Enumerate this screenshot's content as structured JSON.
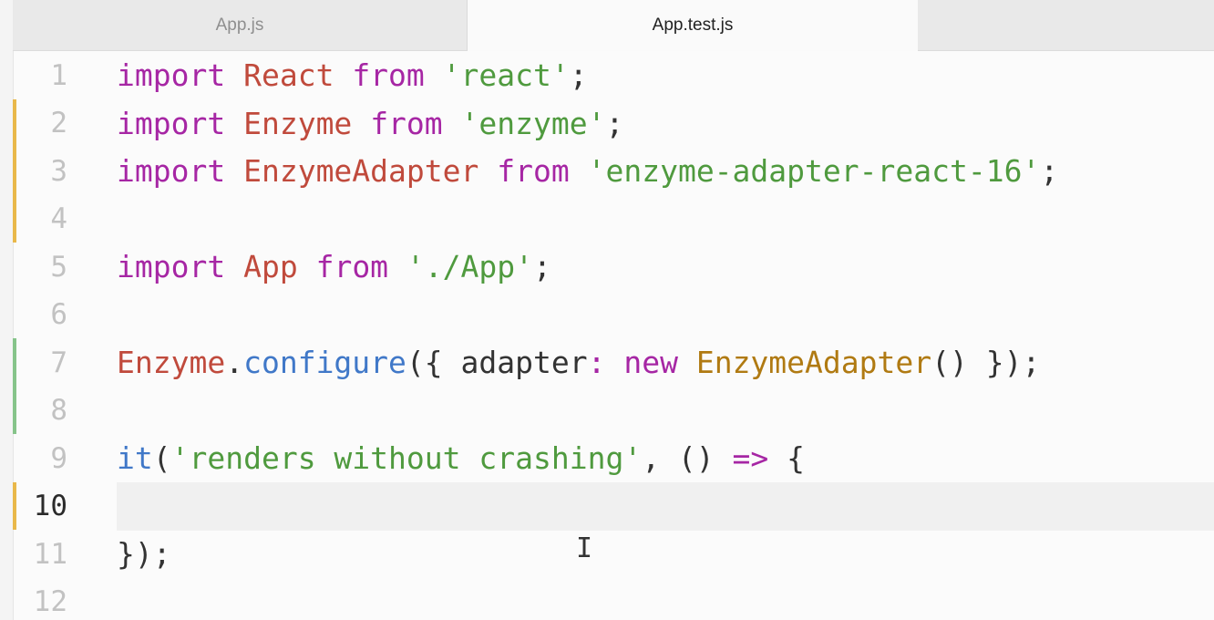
{
  "tabs": [
    {
      "label": "App.js",
      "active": false
    },
    {
      "label": "App.test.js",
      "active": true
    }
  ],
  "colors": {
    "keyword": "#a626a4",
    "class": "#c04a3c",
    "string": "#4f9a3e",
    "function": "#4078c8",
    "constructor": "#b07a12",
    "modified_marker": "#e9b84a",
    "added_marker": "#86c48a"
  },
  "lines": [
    {
      "number": "1",
      "tokens": [
        {
          "t": "import",
          "c": "kw"
        },
        {
          "t": " ",
          "c": "pun"
        },
        {
          "t": "React",
          "c": "cls"
        },
        {
          "t": " ",
          "c": "pun"
        },
        {
          "t": "from",
          "c": "kw"
        },
        {
          "t": " ",
          "c": "pun"
        },
        {
          "t": "'react'",
          "c": "str"
        },
        {
          "t": ";",
          "c": "pun"
        }
      ]
    },
    {
      "number": "2",
      "tokens": [
        {
          "t": "import",
          "c": "kw"
        },
        {
          "t": " ",
          "c": "pun"
        },
        {
          "t": "Enzyme",
          "c": "cls"
        },
        {
          "t": " ",
          "c": "pun"
        },
        {
          "t": "from",
          "c": "kw"
        },
        {
          "t": " ",
          "c": "pun"
        },
        {
          "t": "'enzyme'",
          "c": "str"
        },
        {
          "t": ";",
          "c": "pun"
        }
      ]
    },
    {
      "number": "3",
      "tokens": [
        {
          "t": "import",
          "c": "kw"
        },
        {
          "t": " ",
          "c": "pun"
        },
        {
          "t": "EnzymeAdapter",
          "c": "cls"
        },
        {
          "t": " ",
          "c": "pun"
        },
        {
          "t": "from",
          "c": "kw"
        },
        {
          "t": " ",
          "c": "pun"
        },
        {
          "t": "'enzyme-adapter-react-16'",
          "c": "str"
        },
        {
          "t": ";",
          "c": "pun"
        }
      ]
    },
    {
      "number": "4",
      "tokens": []
    },
    {
      "number": "5",
      "tokens": [
        {
          "t": "import",
          "c": "kw"
        },
        {
          "t": " ",
          "c": "pun"
        },
        {
          "t": "App",
          "c": "cls"
        },
        {
          "t": " ",
          "c": "pun"
        },
        {
          "t": "from",
          "c": "kw"
        },
        {
          "t": " ",
          "c": "pun"
        },
        {
          "t": "'./App'",
          "c": "str"
        },
        {
          "t": ";",
          "c": "pun"
        }
      ]
    },
    {
      "number": "6",
      "tokens": []
    },
    {
      "number": "7",
      "tokens": [
        {
          "t": "Enzyme",
          "c": "cls"
        },
        {
          "t": ".",
          "c": "pun"
        },
        {
          "t": "configure",
          "c": "fn"
        },
        {
          "t": "({ adapter",
          "c": "pun"
        },
        {
          "t": ":",
          "c": "kw"
        },
        {
          "t": " ",
          "c": "pun"
        },
        {
          "t": "new",
          "c": "kw"
        },
        {
          "t": " ",
          "c": "pun"
        },
        {
          "t": "EnzymeAdapter",
          "c": "ctor"
        },
        {
          "t": "() });",
          "c": "pun"
        }
      ]
    },
    {
      "number": "8",
      "tokens": []
    },
    {
      "number": "9",
      "tokens": [
        {
          "t": "it",
          "c": "fn"
        },
        {
          "t": "(",
          "c": "pun"
        },
        {
          "t": "'renders without crashing'",
          "c": "str"
        },
        {
          "t": ", () ",
          "c": "pun"
        },
        {
          "t": "=>",
          "c": "kw"
        },
        {
          "t": " {",
          "c": "pun"
        }
      ]
    },
    {
      "number": "10",
      "tokens": [],
      "current": true
    },
    {
      "number": "11",
      "tokens": [
        {
          "t": "});",
          "c": "pun"
        }
      ]
    },
    {
      "number": "12",
      "tokens": []
    }
  ],
  "gutter_markers": [
    {
      "line": "2",
      "kind": "modified"
    },
    {
      "line": "3",
      "kind": "modified"
    },
    {
      "line": "4",
      "kind": "modified"
    },
    {
      "line": "7",
      "kind": "added"
    },
    {
      "line": "8",
      "kind": "added"
    },
    {
      "line": "10",
      "kind": "modified"
    }
  ],
  "cursor_glyph": "I"
}
